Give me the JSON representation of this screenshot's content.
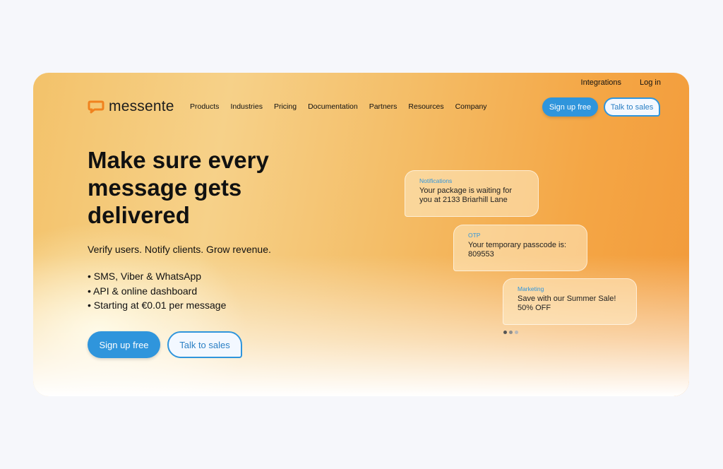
{
  "topbar": {
    "integrations": "Integrations",
    "login": "Log in"
  },
  "logo": {
    "text": "messente",
    "color": "#f0821e"
  },
  "nav": [
    "Products",
    "Industries",
    "Pricing",
    "Documentation",
    "Partners",
    "Resources",
    "Company"
  ],
  "header_buttons": {
    "signup": "Sign up free",
    "sales": "Talk to sales"
  },
  "hero": {
    "title": "Make sure every message gets delivered",
    "subtitle": "Verify users. Notify clients. Grow revenue.",
    "bullets": [
      "SMS, Viber & WhatsApp",
      "API & online dashboard",
      "Starting at €0.01 per message"
    ],
    "signup": "Sign up free",
    "sales": "Talk to sales"
  },
  "bubbles": [
    {
      "tag": "Notifications",
      "message": "Your package is waiting for you at 2133 Briarhill Lane"
    },
    {
      "tag": "OTP",
      "message": "Your temporary passcode is: 809553"
    },
    {
      "tag": "Marketing",
      "message": "Save with our Summer Sale! 50% OFF"
    }
  ],
  "carousel": {
    "slides": 3,
    "active": 1
  },
  "colors": {
    "accent": "#2f95dc",
    "tag": "#2f95dc"
  }
}
